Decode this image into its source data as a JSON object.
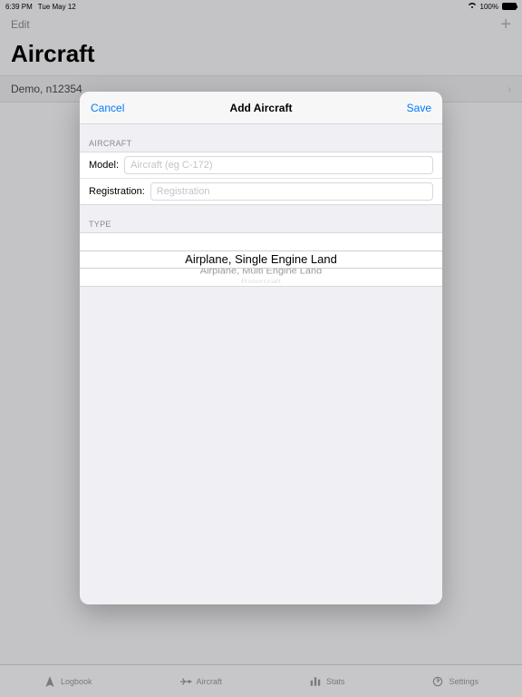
{
  "status": {
    "time": "6:39 PM",
    "date": "Tue May 12",
    "battery": "100%"
  },
  "bgNav": {
    "edit": "Edit",
    "title": "Aircraft",
    "row0": "Demo, n12354"
  },
  "modal": {
    "cancel": "Cancel",
    "title": "Add Aircraft",
    "save": "Save",
    "sectionAircraft": "AIRCRAFT",
    "modelLabel": "Model:",
    "modelPlaceholder": "Aircraft (eg C-172)",
    "regLabel": "Registration:",
    "regPlaceholder": "Registration",
    "sectionType": "TYPE",
    "picker": {
      "above": "",
      "selected": "Airplane, Single Engine Land",
      "below1": "Airplane, Multi Engine Land",
      "below2": "Rotorcraft"
    }
  },
  "tabs": {
    "logbook": "Logbook",
    "aircraft": "Aircraft",
    "stats": "Stats",
    "settings": "Settings"
  }
}
